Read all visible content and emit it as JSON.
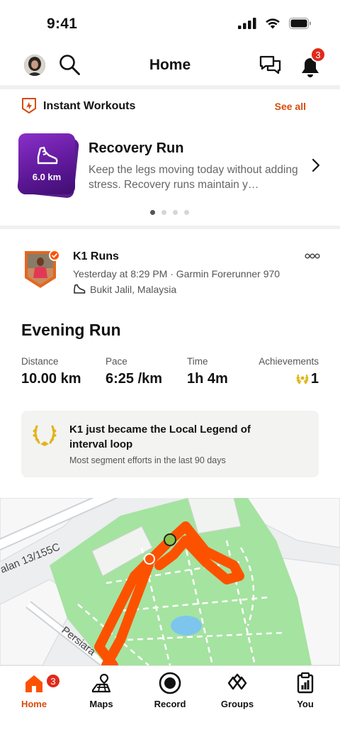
{
  "status_bar": {
    "time": "9:41"
  },
  "header": {
    "title": "Home",
    "notification_count": "3"
  },
  "instant_workouts": {
    "title": "Instant Workouts",
    "see_all": "See all",
    "card": {
      "distance": "6.0 km",
      "title": "Recovery Run",
      "description": "Keep the legs moving today without adding stress. Recovery runs maintain y…"
    },
    "pagination": {
      "count": 4,
      "active": 1
    }
  },
  "activity": {
    "athlete": "K1 Runs",
    "meta": "Yesterday at 8:29 PM · Garmin Forerunner 970",
    "location": "Bukit Jalil, Malaysia",
    "title": "Evening Run",
    "stats": {
      "distance_label": "Distance",
      "distance_value": "10.00 km",
      "pace_label": "Pace",
      "pace_value": "6:25 /km",
      "time_label": "Time",
      "time_value": "1h 4m",
      "achievements_label": "Achievements",
      "achievements_value": "1"
    },
    "legend": {
      "title": "K1 just became the Local Legend of interval loop",
      "subtitle": "Most segment efforts in the last 90 days"
    },
    "map": {
      "street_1": "alan 13/155C",
      "street_2": "Persiara"
    }
  },
  "tabbar": {
    "items": [
      {
        "label": "Home",
        "icon": "home-icon",
        "active": true,
        "badge": "3"
      },
      {
        "label": "Maps",
        "icon": "maps-icon"
      },
      {
        "label": "Record",
        "icon": "record-icon"
      },
      {
        "label": "Groups",
        "icon": "groups-icon"
      },
      {
        "label": "You",
        "icon": "you-icon"
      }
    ]
  },
  "colors": {
    "accent": "#d64b0b",
    "route": "#fc5200",
    "park": "#a5e3a0",
    "badge": "#e02a1b",
    "workout_purple": "#6b1fa8"
  }
}
